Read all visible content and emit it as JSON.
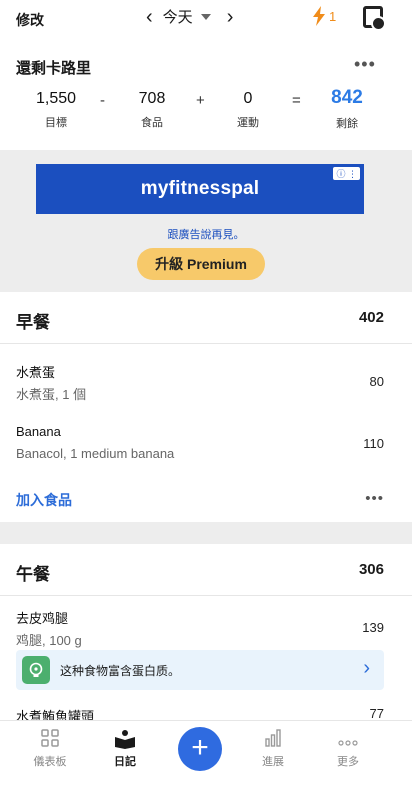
{
  "topbar": {
    "edit_label": "修改",
    "date_label": "今天",
    "prev_arrow": "‹",
    "next_arrow": "›",
    "streak_count": "1",
    "icons": {
      "streak": "lightning-icon",
      "device": "device-sync-icon",
      "date_dropdown": "caret-down-icon"
    }
  },
  "remaining": {
    "title": "還剩卡路里",
    "more": "•••",
    "goal_value": "1,550",
    "goal_label": "目標",
    "minus": "-",
    "food_value": "708",
    "food_label": "食品",
    "plus": "+",
    "exercise_value": "0",
    "exercise_label": "運動",
    "equals": "=",
    "remaining_value": "842",
    "remaining_label": "剩餘"
  },
  "ad": {
    "brand": "myfitnesspal",
    "badge": "ⓘ ⋮",
    "link_text": "跟廣告說再見。",
    "premium_button": "升級 Premium"
  },
  "breakfast": {
    "name": "早餐",
    "calories": "402",
    "items": [
      {
        "name": "水煮蛋",
        "desc": "水煮蛋, 1 個",
        "calories": "80"
      },
      {
        "name": "Banana",
        "desc": "Banacol, 1 medium banana",
        "calories": "110"
      }
    ],
    "add_food": "加入食品",
    "more": "•••"
  },
  "lunch": {
    "name": "午餐",
    "calories": "306",
    "items": [
      {
        "name": "去皮鸡腿",
        "desc": "鸡腿, 100 g",
        "calories": "139"
      },
      {
        "name": "水煮鮪魚罐頭",
        "desc": "",
        "calories": "77"
      }
    ],
    "tip_text": "这种食物富含蛋白质。",
    "tip_chevron": "›"
  },
  "bottomnav": {
    "dashboard": "儀表板",
    "diary": "日記",
    "add": "+",
    "progress": "進展",
    "more": "更多"
  },
  "colors": {
    "accent_blue": "#2c7be5",
    "fab_blue": "#2f6be0",
    "ad_blue": "#1b4fbf",
    "premium_yellow": "#f7c96a",
    "streak_orange": "#f08c1a",
    "tip_green": "#4caf6e"
  }
}
